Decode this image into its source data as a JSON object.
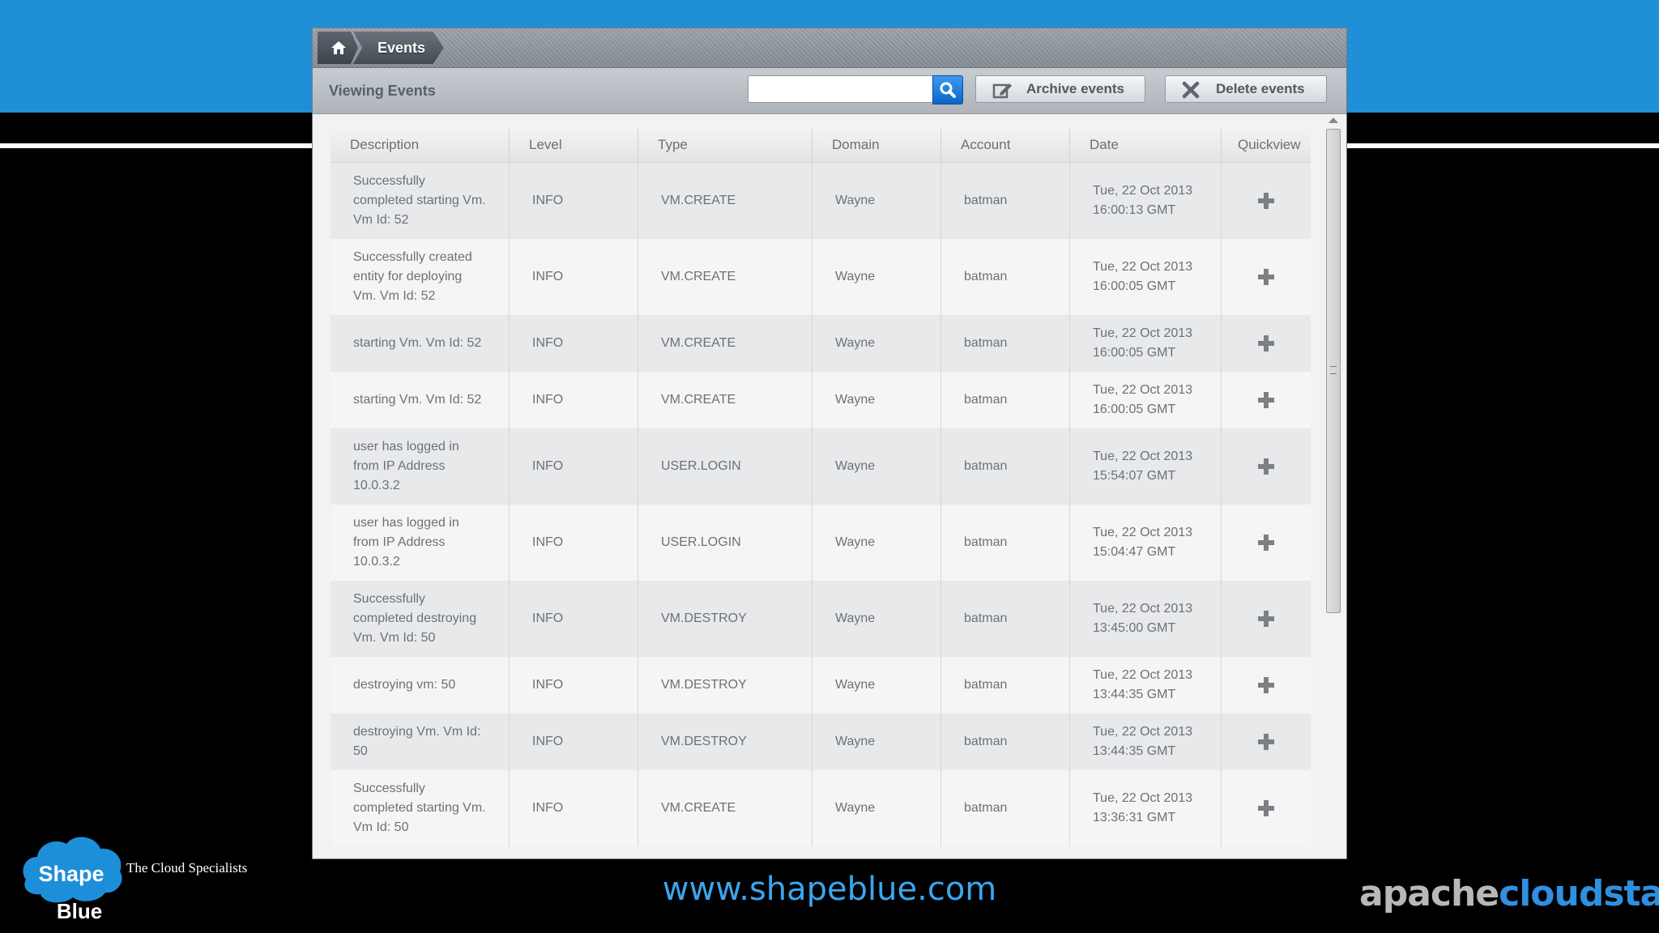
{
  "breadcrumb": {
    "current": "Events"
  },
  "toolbar": {
    "title": "Viewing Events",
    "search_value": "",
    "archive_label": "Archive events",
    "delete_label": "Delete events"
  },
  "table": {
    "columns": [
      "Description",
      "Level",
      "Type",
      "Domain",
      "Account",
      "Date",
      "Quickview"
    ],
    "rows": [
      {
        "description": [
          "Successfully",
          "completed starting Vm.",
          "Vm Id: 52"
        ],
        "level": "INFO",
        "type": "VM.CREATE",
        "domain": "Wayne",
        "account": "batman",
        "date": [
          "Tue, 22 Oct 2013",
          "16:00:13 GMT"
        ]
      },
      {
        "description": [
          "Successfully created",
          "entity for deploying",
          "Vm. Vm Id: 52"
        ],
        "level": "INFO",
        "type": "VM.CREATE",
        "domain": "Wayne",
        "account": "batman",
        "date": [
          "Tue, 22 Oct 2013",
          "16:00:05 GMT"
        ]
      },
      {
        "description": [
          "starting Vm. Vm Id: 52"
        ],
        "level": "INFO",
        "type": "VM.CREATE",
        "domain": "Wayne",
        "account": "batman",
        "date": [
          "Tue, 22 Oct 2013",
          "16:00:05 GMT"
        ]
      },
      {
        "description": [
          "starting Vm. Vm Id: 52"
        ],
        "level": "INFO",
        "type": "VM.CREATE",
        "domain": "Wayne",
        "account": "batman",
        "date": [
          "Tue, 22 Oct 2013",
          "16:00:05 GMT"
        ]
      },
      {
        "description": [
          "user has logged in",
          "from IP Address",
          "10.0.3.2"
        ],
        "level": "INFO",
        "type": "USER.LOGIN",
        "domain": "Wayne",
        "account": "batman",
        "date": [
          "Tue, 22 Oct 2013",
          "15:54:07 GMT"
        ]
      },
      {
        "description": [
          "user has logged in",
          "from IP Address",
          "10.0.3.2"
        ],
        "level": "INFO",
        "type": "USER.LOGIN",
        "domain": "Wayne",
        "account": "batman",
        "date": [
          "Tue, 22 Oct 2013",
          "15:04:47 GMT"
        ]
      },
      {
        "description": [
          "Successfully",
          "completed destroying",
          "Vm. Vm Id: 50"
        ],
        "level": "INFO",
        "type": "VM.DESTROY",
        "domain": "Wayne",
        "account": "batman",
        "date": [
          "Tue, 22 Oct 2013",
          "13:45:00 GMT"
        ]
      },
      {
        "description": [
          "destroying vm: 50"
        ],
        "level": "INFO",
        "type": "VM.DESTROY",
        "domain": "Wayne",
        "account": "batman",
        "date": [
          "Tue, 22 Oct 2013",
          "13:44:35 GMT"
        ]
      },
      {
        "description": [
          "destroying Vm. Vm Id:",
          "50"
        ],
        "level": "INFO",
        "type": "VM.DESTROY",
        "domain": "Wayne",
        "account": "batman",
        "date": [
          "Tue, 22 Oct 2013",
          "13:44:35 GMT"
        ]
      },
      {
        "description": [
          "Successfully",
          "completed starting Vm.",
          "Vm Id: 50"
        ],
        "level": "INFO",
        "type": "VM.CREATE",
        "domain": "Wayne",
        "account": "batman",
        "date": [
          "Tue, 22 Oct 2013",
          "13:36:31 GMT"
        ]
      }
    ]
  },
  "footer": {
    "url": "www.shapeblue.com",
    "logo_text_1": "Shape",
    "logo_text_2": "Blue",
    "tagline": "The Cloud Specialists",
    "brand_part1": "apache",
    "brand_part2": "cloudstack"
  },
  "icons": [
    "home-icon",
    "dropdown-arrow-icon",
    "search-icon",
    "edit-icon",
    "close-icon",
    "plus-icon"
  ],
  "colors": {
    "accent_blue": "#1f8fd6",
    "search_button": "#1c76dc",
    "brand_blue": "#2f8fe0"
  }
}
